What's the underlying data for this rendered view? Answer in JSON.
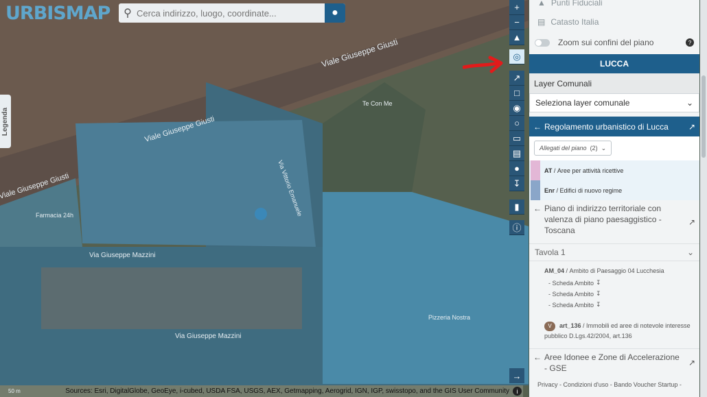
{
  "app": {
    "logo": "URBISMAP"
  },
  "search": {
    "placeholder": "Cerca indirizzo, luogo, coordinate..."
  },
  "legend_tab": "Legenda",
  "map": {
    "streets": [
      "Viale Giuseppe Giusti",
      "Viale Giuseppe Giusti",
      "Viale Giuseppe Giusti",
      "Via Giuseppe Mazzini",
      "Via Giuseppe Mazzini",
      "Via Vittorio Emanuele",
      "Farmacia 24h",
      "Te Con Me",
      "Pizzeria Nostra"
    ],
    "scale": "50 m",
    "attribution": "Sources: Esri, DigitalGlobe, GeoEye, i-cubed, USDA FSA, USGS, AEX, Getmapping, Aerogrid, IGN, IGP, swisstopo, and the GIS User Community"
  },
  "toolbar_icons": [
    "plus-icon",
    "minus-icon",
    "compass-icon",
    "locate-icon",
    "measure-line-icon",
    "measure-area-icon",
    "marker-icon",
    "circle-icon",
    "trash-icon",
    "print-icon",
    "pin-icon",
    "download-icon",
    "bookmark-icon",
    "info-icon"
  ],
  "panel": {
    "top_items": [
      "Punti Fiduciali",
      "Catasto Italia"
    ],
    "zoom_toggle": "Zoom sui confini del piano",
    "city": "LUCCA",
    "layer_comunali": "Layer Comunali",
    "layer_select": "Seleziona layer comunale",
    "regolamento": "Regolamento urbanistico di Lucca",
    "allegati": "Allegati del piano",
    "allegati_count": "(2)",
    "categories": [
      {
        "code": "AT",
        "desc": "Aree per attività ricettive",
        "color": "#e3b7d6"
      },
      {
        "code": "Enr",
        "desc": "Edifici di nuovo regime",
        "color": "#8aa6c9"
      }
    ],
    "piano": "Piano di indirizzo territoriale con valenza di piano paesaggistico - Toscana",
    "tavola": "Tavola 1",
    "am_code": "AM_04",
    "am_desc": "Ambito di Paesaggio 04 Lucchesia",
    "schede": [
      "- Scheda Ambito",
      "- Scheda Ambito",
      "- Scheda Ambito"
    ],
    "art_badge": "V",
    "art_code": "art_136",
    "art_desc": "Immobili ed aree di notevole interesse pubblico D.Lgs.42/2004, art.136",
    "aree": "Aree Idonee e Zone di Accelerazione - GSE",
    "footer_links": "Privacy - Condizioni d'uso - Bando Voucher Startup -"
  }
}
